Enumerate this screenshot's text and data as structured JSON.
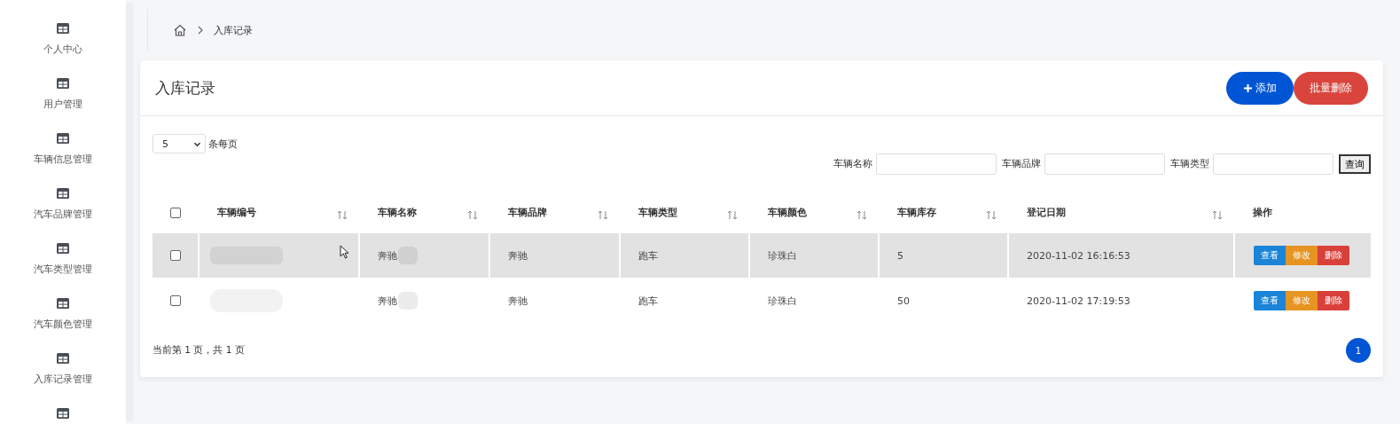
{
  "sidebar": {
    "items": [
      {
        "kind": "labeled",
        "label": "个人中心"
      },
      {
        "kind": "labeled",
        "label": "用户管理"
      },
      {
        "kind": "labeled",
        "label": "车辆信息管理"
      },
      {
        "kind": "labeled",
        "label": "汽车品牌管理"
      },
      {
        "kind": "labeled",
        "label": "汽车类型管理"
      },
      {
        "kind": "labeled",
        "label": "汽车颜色管理"
      },
      {
        "kind": "labeled",
        "label": "入库记录管理"
      },
      {
        "kind": "icon_only"
      }
    ]
  },
  "breadcrumb": {
    "items": [
      "入库记录"
    ]
  },
  "card": {
    "title": "入库记录",
    "add_button": "添加",
    "batch_delete_button": "批量删除",
    "page_size": {
      "value": "5",
      "label": "条每页"
    },
    "search": {
      "fields": [
        {
          "label": "车辆名称"
        },
        {
          "label": "车辆品牌"
        },
        {
          "label": "车辆类型"
        }
      ],
      "button": "查询"
    },
    "table": {
      "columns": [
        {
          "label": "车辆编号",
          "sortable": true
        },
        {
          "label": "车辆名称",
          "sortable": true
        },
        {
          "label": "车辆品牌",
          "sortable": true
        },
        {
          "label": "车辆类型",
          "sortable": true
        },
        {
          "label": "车辆颜色",
          "sortable": true
        },
        {
          "label": "车辆库存",
          "sortable": true
        },
        {
          "label": "登记日期",
          "sortable": true
        },
        {
          "label": "操作",
          "sortable": false
        }
      ],
      "header_checked": false,
      "rows": [
        {
          "checked": false,
          "hovered": true,
          "cells": [
            "",
            "奔驰",
            "奔驰",
            "跑车",
            "珍珠白",
            "5",
            "2020-11-02 16:16:53"
          ],
          "actions": [
            "查看",
            "修改",
            "删除"
          ]
        },
        {
          "checked": false,
          "hovered": false,
          "cells": [
            "",
            "奔驰",
            "奔驰",
            "跑车",
            "珍珠白",
            "50",
            "2020-11-02 17:19:53"
          ],
          "actions": [
            "查看",
            "修改",
            "删除"
          ]
        }
      ]
    },
    "page_info": "当前第 1 页，共 1 页",
    "pages": [
      {
        "label": "1",
        "selected": true
      }
    ]
  }
}
